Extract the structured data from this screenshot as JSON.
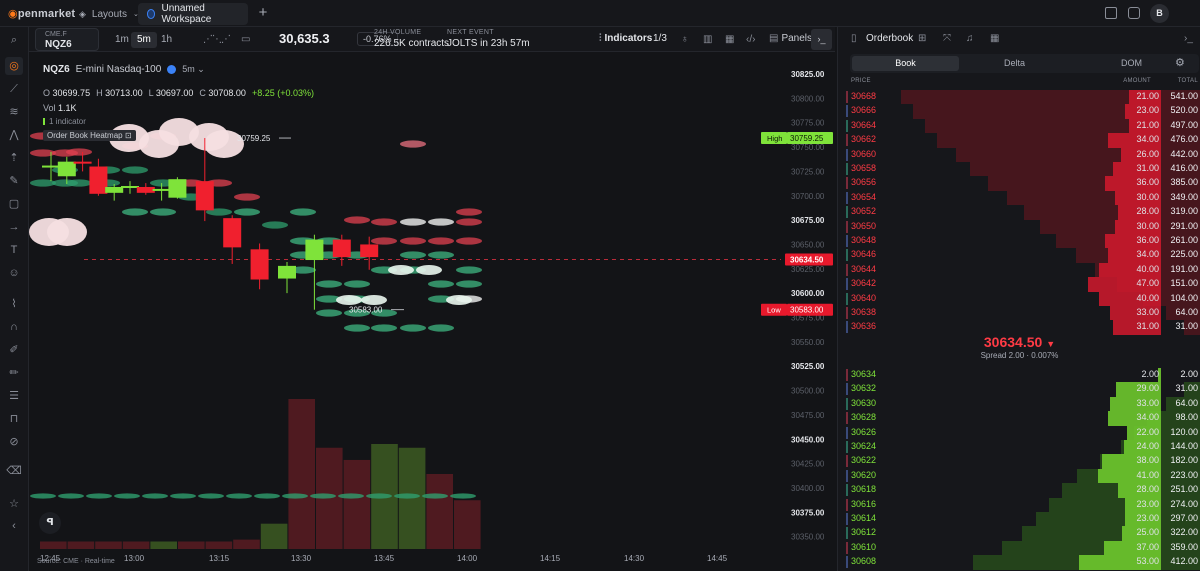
{
  "app": {
    "logo_text": "penmarket",
    "tabs": [
      {
        "label": "Layouts"
      },
      {
        "label": "Unnamed Workspace"
      }
    ],
    "avatar": "B"
  },
  "toolbar": {
    "symbol_exchange": "CME.F",
    "symbol": "NQZ6",
    "timeframes": [
      "1m",
      "5m",
      "1h"
    ],
    "active_timeframe": "5m",
    "price": "30,635.3",
    "change": "-0.76%",
    "volume_label": "24H VOLUME",
    "volume_value": "226.5K contracts",
    "event_label": "NEXT EVENT",
    "event_value": "JOLTS  in 23h 57m",
    "indicators_label": "Indicators",
    "indicators_count": "1/3",
    "panels_label": "Panels"
  },
  "legend": {
    "symbol": "NQZ6",
    "name": "E-mini Nasdaq-100",
    "timeframe": "5m",
    "open_label": "O",
    "open": "30699.75",
    "high_label": "H",
    "high": "30713.00",
    "low_label": "L",
    "low": "30697.00",
    "close_label": "C",
    "close": "30708.00",
    "change": "+8.25 (+0.03%)",
    "vol_label": "Vol",
    "vol": "1.1K",
    "indicator_count": "1 indicator",
    "heatmap_label": "Order Book Heatmap",
    "source": "Source: CME · Real-time"
  },
  "chart_data": {
    "type": "candlestick",
    "x_labels": [
      "12:45",
      "13:00",
      "13:15",
      "13:30",
      "13:45",
      "14:00",
      "14:15",
      "14:30",
      "14:45"
    ],
    "y_ticks": [
      30825,
      30800,
      30775,
      30750,
      30725,
      30700,
      30675,
      30650,
      30625,
      30600,
      30575,
      30550,
      30525,
      30500,
      30475,
      30450,
      30425,
      30400,
      30375,
      30350
    ],
    "y_tick_labels": [
      "30825.00",
      "30800.00",
      "30775.00",
      "30750.00",
      "30725.00",
      "30700.00",
      "30675.00",
      "30650.00",
      "30625.00",
      "30600.00",
      "30575.00",
      "30550.00",
      "30525.00",
      "30500.00",
      "30475.00",
      "30450.00",
      "30425.00",
      "30400.00",
      "30375.00",
      "30350.00"
    ],
    "y_bold_ticks": [
      30825,
      30675,
      30600,
      30525,
      30450,
      30375
    ],
    "ylim": [
      30350,
      30850
    ],
    "candles": [
      {
        "t": "12:45",
        "o": 30730,
        "h": 30745,
        "l": 30715,
        "c": 30731
      },
      {
        "t": "12:50",
        "o": 30720,
        "h": 30740,
        "l": 30712,
        "c": 30735
      },
      {
        "t": "12:55",
        "o": 30735,
        "h": 30745,
        "l": 30725,
        "c": 30734
      },
      {
        "t": "13:00",
        "o": 30730,
        "h": 30738,
        "l": 30700,
        "c": 30702
      },
      {
        "t": "13:05",
        "o": 30703,
        "h": 30712,
        "l": 30695,
        "c": 30709
      },
      {
        "t": "13:10",
        "o": 30708,
        "h": 30715,
        "l": 30702,
        "c": 30710
      },
      {
        "t": "13:15",
        "o": 30709,
        "h": 30713,
        "l": 30701,
        "c": 30703
      },
      {
        "t": "13:20",
        "o": 30706,
        "h": 30713,
        "l": 30695,
        "c": 30707
      },
      {
        "t": "13:25",
        "o": 30698,
        "h": 30719,
        "l": 30697,
        "c": 30717
      },
      {
        "t": "13:30",
        "o": 30715,
        "h": 30759.25,
        "l": 30674,
        "c": 30685
      },
      {
        "t": "13:35",
        "o": 30677,
        "h": 30680,
        "l": 30630,
        "c": 30647
      },
      {
        "t": "13:40",
        "o": 30645,
        "h": 30651,
        "l": 30604,
        "c": 30614
      },
      {
        "t": "13:45",
        "o": 30615,
        "h": 30632,
        "l": 30600,
        "c": 30628
      },
      {
        "t": "13:50",
        "o": 30634,
        "h": 30660,
        "l": 30583,
        "c": 30655
      },
      {
        "t": "13:55",
        "o": 30655,
        "h": 30660,
        "l": 30628,
        "c": 30637
      },
      {
        "t": "14:00",
        "o": 30650,
        "h": 30658,
        "l": 30624,
        "c": 30637
      }
    ],
    "volume": [
      8,
      8,
      8,
      8,
      8,
      8,
      8,
      10,
      27,
      160,
      108,
      95,
      112,
      108,
      80,
      52
    ],
    "volume_colors": [
      "down",
      "down",
      "down",
      "down",
      "up",
      "down",
      "down",
      "down",
      "up",
      "down",
      "down",
      "down",
      "up",
      "up",
      "down",
      "down"
    ],
    "high_marker": {
      "label": "High",
      "value": "30759.25"
    },
    "low_marker": {
      "label": "Low",
      "value": "30583.00"
    },
    "last_price": "30634.50",
    "annot_high": "30759.25",
    "annot_low": "30583.00"
  },
  "orderbook": {
    "title": "Orderbook",
    "tabs": [
      "Book",
      "Delta",
      "DOM"
    ],
    "active_tab": "Book",
    "col_price": "PRICE",
    "col_amount": "AMOUNT",
    "col_total": "TOTAL",
    "asks": [
      {
        "price": "30668",
        "amount": "21.00",
        "total": "541.00"
      },
      {
        "price": "30666",
        "amount": "23.00",
        "total": "520.00"
      },
      {
        "price": "30664",
        "amount": "21.00",
        "total": "497.00"
      },
      {
        "price": "30662",
        "amount": "34.00",
        "total": "476.00"
      },
      {
        "price": "30660",
        "amount": "26.00",
        "total": "442.00"
      },
      {
        "price": "30658",
        "amount": "31.00",
        "total": "416.00"
      },
      {
        "price": "30656",
        "amount": "36.00",
        "total": "385.00"
      },
      {
        "price": "30654",
        "amount": "30.00",
        "total": "349.00"
      },
      {
        "price": "30652",
        "amount": "28.00",
        "total": "319.00"
      },
      {
        "price": "30650",
        "amount": "30.00",
        "total": "291.00"
      },
      {
        "price": "30648",
        "amount": "36.00",
        "total": "261.00"
      },
      {
        "price": "30646",
        "amount": "34.00",
        "total": "225.00"
      },
      {
        "price": "30644",
        "amount": "40.00",
        "total": "191.00"
      },
      {
        "price": "30642",
        "amount": "47.00",
        "total": "151.00"
      },
      {
        "price": "30640",
        "amount": "40.00",
        "total": "104.00"
      },
      {
        "price": "30638",
        "amount": "33.00",
        "total": "64.00"
      },
      {
        "price": "30636",
        "amount": "31.00",
        "total": "31.00"
      }
    ],
    "mid_price": "30634.50",
    "spread": "Spread  2.00 · 0.007%",
    "bids": [
      {
        "price": "30634",
        "amount": "2.00",
        "total": "2.00"
      },
      {
        "price": "30632",
        "amount": "29.00",
        "total": "31.00"
      },
      {
        "price": "30630",
        "amount": "33.00",
        "total": "64.00"
      },
      {
        "price": "30628",
        "amount": "34.00",
        "total": "98.00"
      },
      {
        "price": "30626",
        "amount": "22.00",
        "total": "120.00"
      },
      {
        "price": "30624",
        "amount": "24.00",
        "total": "144.00"
      },
      {
        "price": "30622",
        "amount": "38.00",
        "total": "182.00"
      },
      {
        "price": "30620",
        "amount": "41.00",
        "total": "223.00"
      },
      {
        "price": "30618",
        "amount": "28.00",
        "total": "251.00"
      },
      {
        "price": "30616",
        "amount": "23.00",
        "total": "274.00"
      },
      {
        "price": "30614",
        "amount": "23.00",
        "total": "297.00"
      },
      {
        "price": "30612",
        "amount": "25.00",
        "total": "322.00"
      },
      {
        "price": "30610",
        "amount": "37.00",
        "total": "359.00"
      },
      {
        "price": "30608",
        "amount": "53.00",
        "total": "412.00"
      }
    ],
    "max_total": 541
  },
  "colors": {
    "up": "#7fe33a",
    "down": "#f0202e",
    "ask": "#ff3b45",
    "bid": "#7fe33a",
    "accent": "#ff7a1a"
  }
}
